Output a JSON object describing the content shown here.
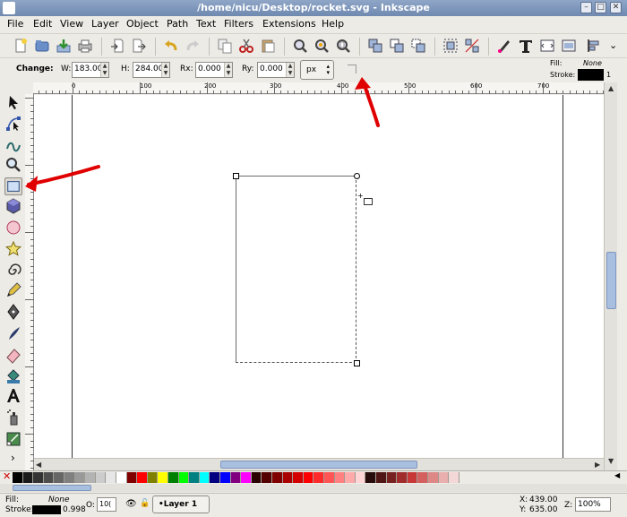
{
  "window": {
    "title": "/home/nicu/Desktop/rocket.svg - Inkscape",
    "minimize_glyph": "–",
    "maximize_glyph": "□",
    "close_glyph": "✕"
  },
  "menu": [
    "File",
    "Edit",
    "View",
    "Layer",
    "Object",
    "Path",
    "Text",
    "Filters",
    "Extensions",
    "Help"
  ],
  "command_toolbar": {
    "icons": [
      "new-document-icon",
      "open-icon",
      "save-icon",
      "print-icon",
      "import-icon",
      "export-icon",
      "undo-icon",
      "redo-icon",
      "copy-icon",
      "cut-icon",
      "paste-icon",
      "zoom-selection-icon",
      "zoom-drawing-icon",
      "zoom-page-icon",
      "duplicate-icon",
      "clone-icon",
      "unlink-clone-icon",
      "group-icon",
      "ungroup-icon",
      "fill-stroke-icon",
      "text-font-icon",
      "xml-editor-icon",
      "align-distribute-icon"
    ],
    "overflow_glyph": "⌄"
  },
  "rect_controls": {
    "change_label": "Change:",
    "w_label": "W:",
    "w_value": "183.003",
    "h_label": "H:",
    "h_value": "284.003",
    "rx_label": "Rx:",
    "rx_value": "0.000",
    "ry_label": "Ry:",
    "ry_value": "0.000",
    "unit": "px",
    "spin_up": "▲",
    "spin_down": "▼"
  },
  "style_indicator": {
    "fill_label": "Fill:",
    "fill_value": "None",
    "stroke_label": "Stroke:",
    "stroke_width": "1",
    "stroke_color": "#000000"
  },
  "ruler": {
    "labels": [
      "0",
      "100",
      "200",
      "300",
      "400",
      "500",
      "600",
      "700"
    ]
  },
  "tools": [
    "selector-tool-icon",
    "node-tool-icon",
    "tweak-tool-icon",
    "zoom-tool-icon",
    "rectangle-tool-icon",
    "3d-box-tool-icon",
    "ellipse-tool-icon",
    "star-tool-icon",
    "spiral-tool-icon",
    "pencil-tool-icon",
    "pen-tool-icon",
    "calligraphy-tool-icon",
    "eraser-tool-icon",
    "paint-bucket-tool-icon",
    "text-tool-icon",
    "spray-tool-icon",
    "gradient-tool-icon"
  ],
  "toolbox_more_glyph": "›",
  "scroll_glyphs": {
    "left": "◀",
    "right": "▶",
    "up": "▲",
    "down": "▼"
  },
  "palette": {
    "none_glyph": "✕",
    "colors": [
      "#000000",
      "#1a1a1a",
      "#333333",
      "#4d4d4d",
      "#666666",
      "#808080",
      "#999999",
      "#b3b3b3",
      "#cccccc",
      "#e6e6e6",
      "#ffffff",
      "#800000",
      "#ff0000",
      "#808000",
      "#ffff00",
      "#008000",
      "#00ff00",
      "#008080",
      "#00ffff",
      "#000080",
      "#0000ff",
      "#800080",
      "#ff00ff",
      "#2b0000",
      "#550000",
      "#800000",
      "#aa0000",
      "#d40000",
      "#ff0000",
      "#ff2a2a",
      "#ff5555",
      "#ff8080",
      "#ffaaaa",
      "#ffd5d5",
      "#280b0b",
      "#501616",
      "#782121",
      "#a02c2c",
      "#c83737",
      "#d35f5f",
      "#de8787",
      "#e9afaf",
      "#f4d7d7"
    ]
  },
  "status": {
    "fill_label": "Fill:",
    "fill_value": "None",
    "stroke_label": "Stroke:",
    "stroke_width": "0.998",
    "stroke_color": "#000000",
    "opacity_label": "O:",
    "opacity_value": "10(",
    "layer": "•Layer 1",
    "x_label": "X:",
    "x_value": "439.00",
    "y_label": "Y:",
    "y_value": "635.00",
    "zoom_label": "Z:",
    "zoom_value": "100%"
  },
  "colors": {
    "annotation_arrow": "#e00000",
    "selection_handle": "#ffffff"
  }
}
